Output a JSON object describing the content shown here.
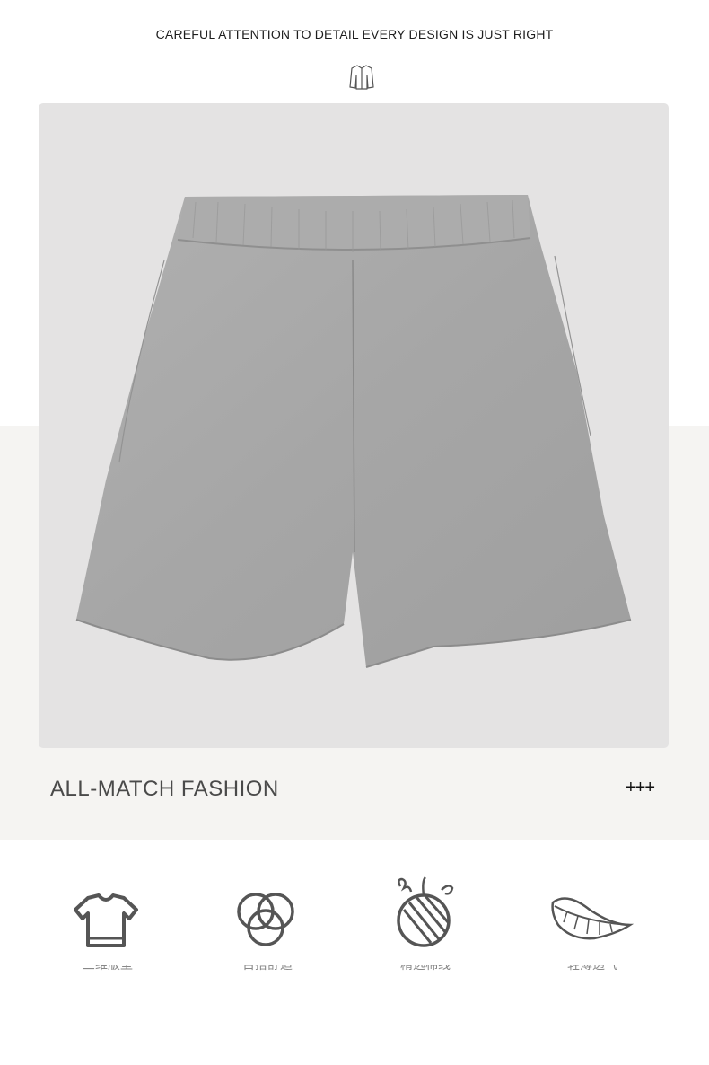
{
  "header": {
    "tagline": "CAREFUL ATTENTION TO DETAIL EVERY DESIGN IS JUST RIGHT",
    "icon": "jacket-icon"
  },
  "product": {
    "image": "gray-shorts-photo",
    "colors": {
      "panel": "#e4e3e3",
      "band": "#f5f4f2",
      "fabric": "#a9a9a9"
    }
  },
  "section": {
    "title": "ALL-MATCH FASHION",
    "plus": "+++"
  },
  "features": [
    {
      "icon": "tshirt-icon",
      "label": "三维版型"
    },
    {
      "icon": "rings-icon",
      "label": "百搭舒适"
    },
    {
      "icon": "yarn-ball-icon",
      "label": "精选棉线"
    },
    {
      "icon": "feather-icon",
      "label": "轻薄透气"
    }
  ]
}
